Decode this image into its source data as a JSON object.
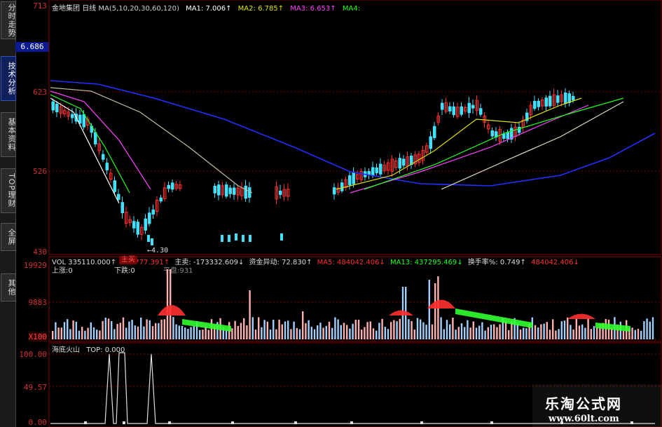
{
  "sidebar": {
    "tabs": [
      {
        "label": "分时走势",
        "active": false
      },
      {
        "label": "技术分析",
        "active": true
      },
      {
        "label": "基本资料",
        "active": false
      },
      {
        "label": "TOP理财",
        "active": false
      },
      {
        "label": "全屏",
        "active": false
      },
      {
        "label": "其他",
        "active": false
      }
    ]
  },
  "price_panel": {
    "stock_name": "金地集团",
    "period": "日线",
    "ma_params": "MA(5,10,20,30,60,120)",
    "ma1_label": "MA1:",
    "ma1_value": "7.006↑",
    "ma2_label": "MA2:",
    "ma2_value": "6.785↑",
    "ma3_label": "MA3:",
    "ma3_value": "6.653↑",
    "ma4_label": "MA4:",
    "current_price": "6.686",
    "y_labels": [
      "713",
      "623",
      "526",
      "430"
    ],
    "low_label": "4.30"
  },
  "volume_panel": {
    "vol_label": "VOL",
    "vol_value": "335110.000↑",
    "v2": "161777.391↑",
    "tag_zhumai": "主买",
    "zhumai_label": "主卖:",
    "zhumai_value": "-173332.609↓",
    "zijin_label": "资金异动:",
    "zijin_value": "72.830↑",
    "ma5_label": "MA5:",
    "ma5_value": "484042.406↓",
    "ma13_label": "MA13:",
    "ma13_value": "437295.469↓",
    "turnover_label": "换手率%:",
    "turnover_value": "0.749↑",
    "tail_value": "484042.406↓",
    "tail_label": "MA5",
    "up_label": "上涨:0",
    "down_label": "下跌:0",
    "flat_label": "平盘:931",
    "y_labels": [
      "19929",
      "9883",
      "X100"
    ]
  },
  "indicator_panel": {
    "name": "海底火山",
    "top_label": "TOP:",
    "top_value": "0.000",
    "y_labels": [
      "100.00",
      "49.57",
      "0.00"
    ]
  },
  "watermark": {
    "cn": "乐淘公式网",
    "url": "www.60lt.com"
  },
  "colors": {
    "up": "#ff3030",
    "down": "#40e0ff",
    "ma1": "#ffffff",
    "ma2": "#e0e000",
    "ma3": "#ff40ff",
    "ma4": "#20ff20",
    "ma5": "#2030ff",
    "grid": "#7a0000"
  }
}
